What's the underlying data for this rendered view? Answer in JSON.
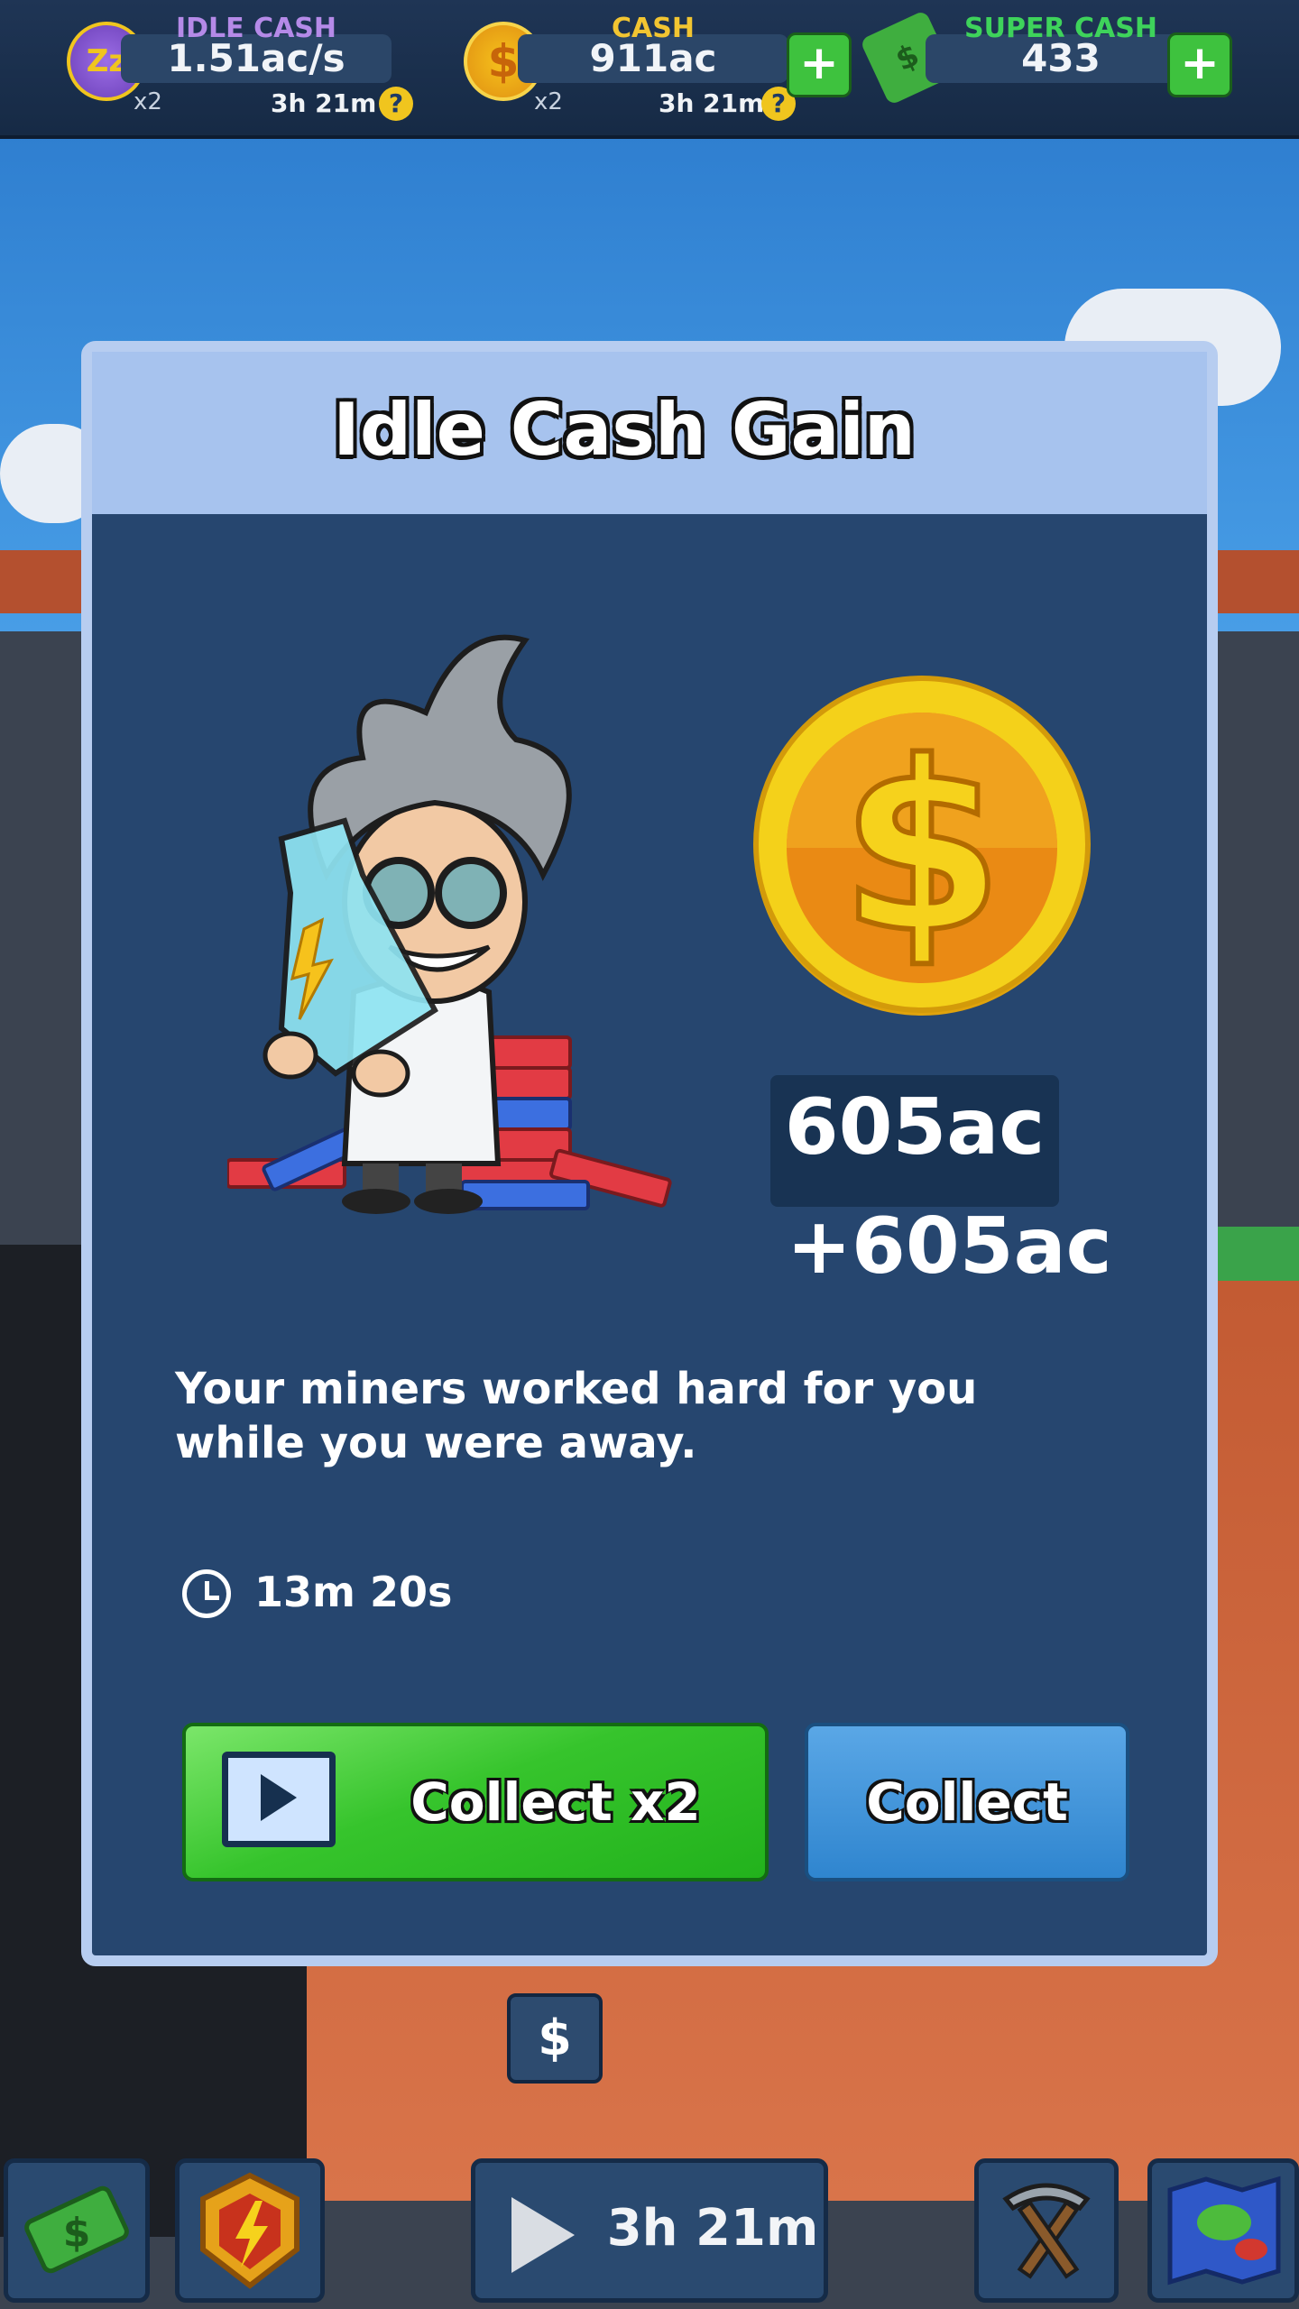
{
  "hud": {
    "idle_cash": {
      "label": "IDLE CASH",
      "value": "1.51ac/s",
      "multiplier": "x2",
      "timer": "3h 21m",
      "help": "?"
    },
    "cash": {
      "label": "CASH",
      "value": "911ac",
      "multiplier": "x2",
      "timer": "3h 21m",
      "help": "?",
      "add": "+"
    },
    "super_cash": {
      "label": "SUPER CASH",
      "value": "433",
      "add": "+"
    }
  },
  "modal": {
    "title": "Idle Cash Gain",
    "amount": "605ac",
    "gain": "+605ac",
    "message": "Your miners worked hard for you while you were away.",
    "duration": "13m 20s",
    "collect_x2": "Collect x2",
    "collect": "Collect"
  },
  "bottom": {
    "boost_timer": "3h 21m"
  },
  "colors": {
    "idle_label": "#b58ae8",
    "cash_label": "#f2c531",
    "super_label": "#3ed35b",
    "green_button": "#2fbf26",
    "blue_button": "#3b8fd6"
  },
  "icons": [
    "idle-cash-icon",
    "cash-coin-icon",
    "super-cash-icon",
    "help-icon",
    "plus-icon",
    "video-icon",
    "clock-icon",
    "play-icon",
    "shield-lightning-icon",
    "pickaxe-icon",
    "map-icon",
    "withdraw-icon"
  ]
}
